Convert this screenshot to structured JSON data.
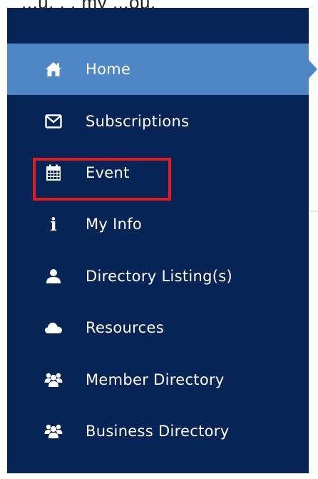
{
  "page_fragment": "...u. . . my ...ou.",
  "nav": {
    "items": [
      {
        "label": "Home",
        "icon": "home-icon",
        "active": true
      },
      {
        "label": "Subscriptions",
        "icon": "envelope-icon",
        "active": false
      },
      {
        "label": "Event",
        "icon": "calendar-icon",
        "active": false
      },
      {
        "label": "My Info",
        "icon": "info-icon",
        "active": false,
        "highlighted": true
      },
      {
        "label": "Directory Listing(s)",
        "icon": "user-icon",
        "active": false
      },
      {
        "label": "Resources",
        "icon": "cloud-icon",
        "active": false
      },
      {
        "label": "Member Directory",
        "icon": "users-icon",
        "active": false
      },
      {
        "label": "Business Directory",
        "icon": "users-icon",
        "active": false
      }
    ],
    "info_glyph": "i"
  },
  "colors": {
    "sidebar_bg": "#072457",
    "active_bg": "#4f86c6",
    "highlight_border": "#e31b1b",
    "text": "#ffffff"
  }
}
